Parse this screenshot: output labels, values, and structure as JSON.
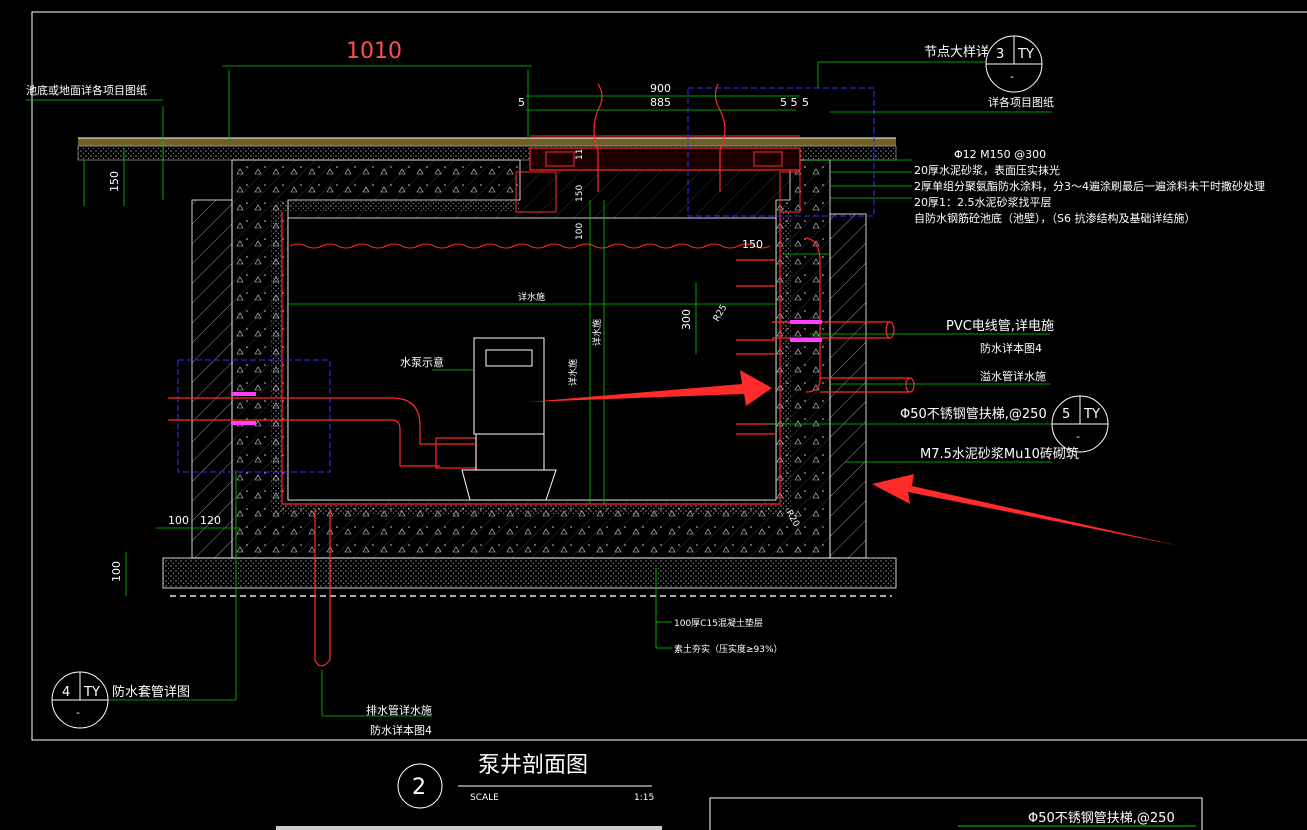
{
  "drawing": {
    "dim_top": "1010",
    "dim_900": "900",
    "dim_885": "885",
    "dim_5a": "5",
    "dim_5b": "5",
    "dim_55": "5 5",
    "dim_150_left": "150",
    "dim_150_mid": "150",
    "dim_100_mid": "100",
    "dim_11": "11",
    "dim_150_right": "150",
    "dim_300": "300",
    "dim_r25": "R25",
    "dim_r20": "R20",
    "dim_100_base": "100",
    "dim_100_bottom": "100",
    "dim_120_bottom": "120",
    "inner_width_label": "详水施",
    "inner_height_label_a": "详水施",
    "inner_height_label_b": "详水施",
    "pump_label": "水泵示意",
    "left_top_note": "池底或地面详各项目图纸",
    "node_detail": "节点大样详",
    "node_detail_id": "3",
    "node_detail_sheet": "TY",
    "node_detail_sub": "-",
    "project_note": "详各项目图纸",
    "rebar": "Φ12 M150 @300",
    "layer1": "20厚水泥砂浆，表面压实抹光",
    "layer2": "2厚单组分聚氨酯防水涂料，分3～4遍涂刷最后一遍涂料未干时撒砂处理",
    "layer3": "20厚1：2.5水泥砂浆找平层",
    "layer4": "自防水钢筋砼池底（池壁），（S6 抗渗结构及基础详结施）",
    "pvc_note": "PVC电线管,详电施",
    "waterproof_note_a": "防水详本图4",
    "overflow_note": "溢水管详水施",
    "ladder_note": "Φ50不锈钢管扶梯,@250",
    "ladder_id": "5",
    "ladder_sheet": "TY",
    "ladder_sub": "-",
    "brick_note": "M7.5水泥砂浆Mu10砖砌筑",
    "base_note_a": "100厚C15混凝土垫层",
    "base_note_b": "素土夯实（压实度≥93%）",
    "sleeve_id": "4",
    "sleeve_sheet": "TY",
    "sleeve_sub": "-",
    "sleeve_note": "防水套管详图",
    "drain_note_a": "排水管详水施",
    "drain_note_b": "防水详本图4",
    "title_num": "2",
    "title": "泵井剖面图",
    "scale_label": "SCALE",
    "scale_value": "1:15",
    "bottom_box_text": "Φ50不锈钢管扶梯,@250"
  },
  "colors": {
    "background": "#000000",
    "frame": "#ffffff",
    "dimension": "#00ff00",
    "pipe": "#ff2020",
    "hidden": "#3030ff",
    "membrane": "#ff40ff",
    "arrow": "#ff2a2a"
  }
}
